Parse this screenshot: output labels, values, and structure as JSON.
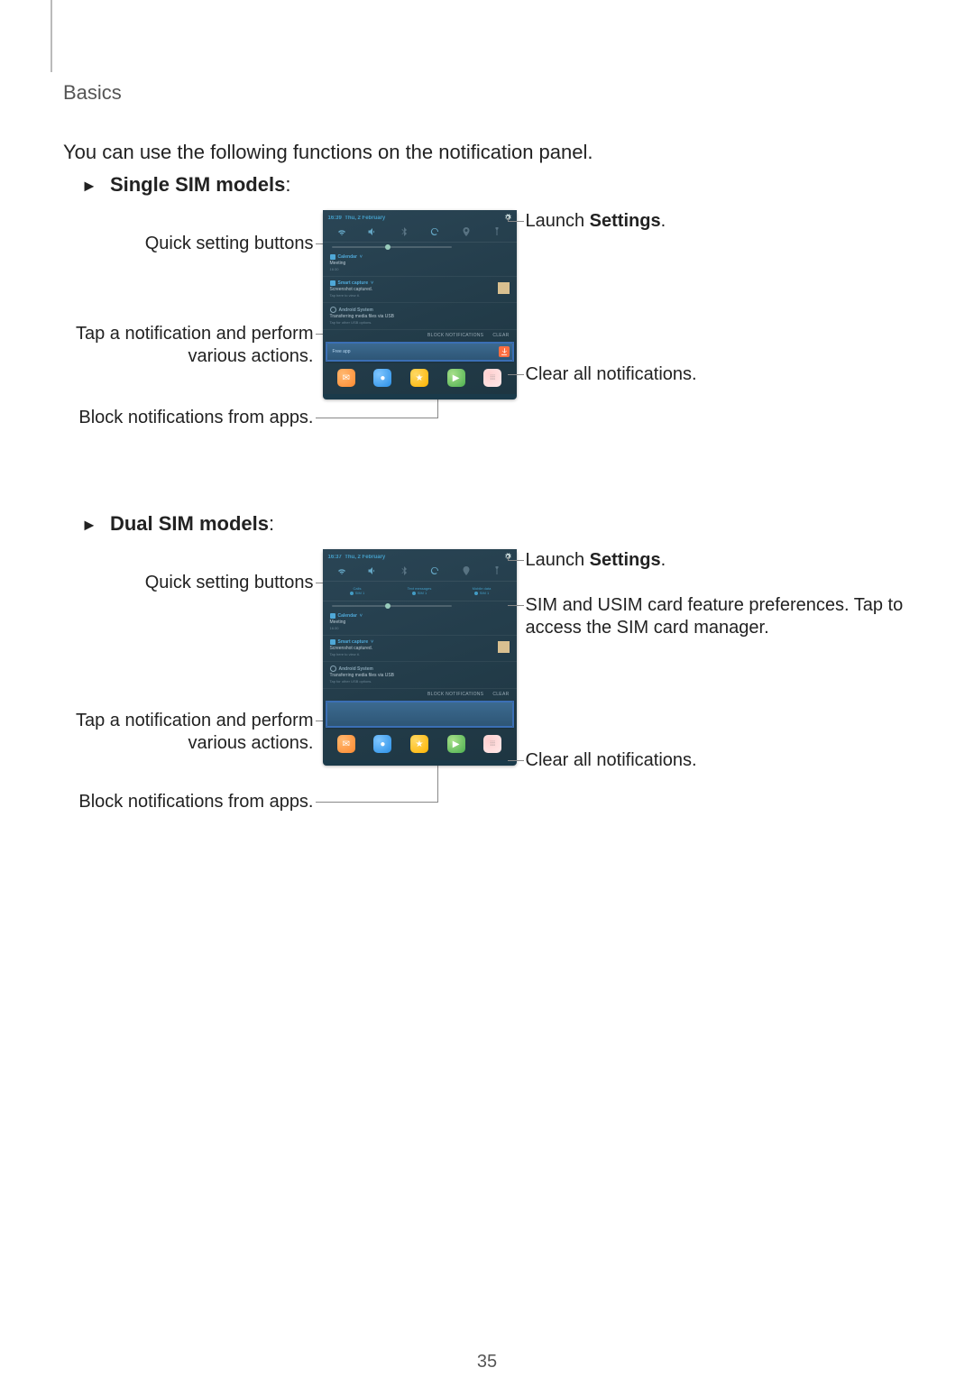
{
  "breadcrumb": "Basics",
  "intro": "You can use the following functions on the notification panel.",
  "page_number": "35",
  "section_single": {
    "heading": "Single SIM models",
    "colon": ":",
    "left_callouts": {
      "quick_settings": "Quick setting buttons",
      "tap_notification": "Tap a notification and perform various actions.",
      "block": "Block notifications from apps."
    },
    "right_callouts": {
      "settings_prefix": "Launch ",
      "settings_bold": "Settings",
      "settings_suffix": ".",
      "clear": "Clear all notifications."
    },
    "phone": {
      "status_time": "16:39",
      "status_date": "Thu, 2 February",
      "notif1_title": "Calendar",
      "notif1_sub": "Meeting",
      "notif1_meta": "16:30",
      "notif2_title": "Smart capture",
      "notif2_sub": "Screenshot captured.",
      "notif2_meta": "Tap here to view it.",
      "notif3_title": "Android System",
      "notif3_sub": "Transferring media files via USB",
      "notif3_meta": "Tap for other USB options.",
      "block_button": "BLOCK NOTIFICATIONS",
      "clear_button": "CLEAR",
      "highlight_text": "Free app"
    }
  },
  "section_dual": {
    "heading": "Dual SIM models",
    "colon": ":",
    "left_callouts": {
      "quick_settings": "Quick setting buttons",
      "tap_notification": "Tap a notification and perform various actions.",
      "block": "Block notifications from apps."
    },
    "right_callouts": {
      "settings_prefix": "Launch ",
      "settings_bold": "Settings",
      "settings_suffix": ".",
      "sim_pref": "SIM and USIM card feature preferences. Tap to access the SIM card manager.",
      "clear": "Clear all notifications."
    },
    "phone": {
      "status_time": "16:37",
      "status_date": "Thu, 2 February",
      "sim_calls": "Calls",
      "sim_msgs": "Text messages",
      "sim_data": "Mobile data",
      "sim_val": "SIM 1",
      "notif1_title": "Calendar",
      "notif1_sub": "Meeting",
      "notif1_meta": "16:30",
      "notif2_title": "Smart capture",
      "notif2_sub": "Screenshot captured.",
      "notif2_meta": "Tap here to view it.",
      "notif3_title": "Android System",
      "notif3_sub": "Transferring media files via USB",
      "notif3_meta": "Tap for other USB options.",
      "block_button": "BLOCK NOTIFICATIONS",
      "clear_button": "CLEAR"
    }
  }
}
